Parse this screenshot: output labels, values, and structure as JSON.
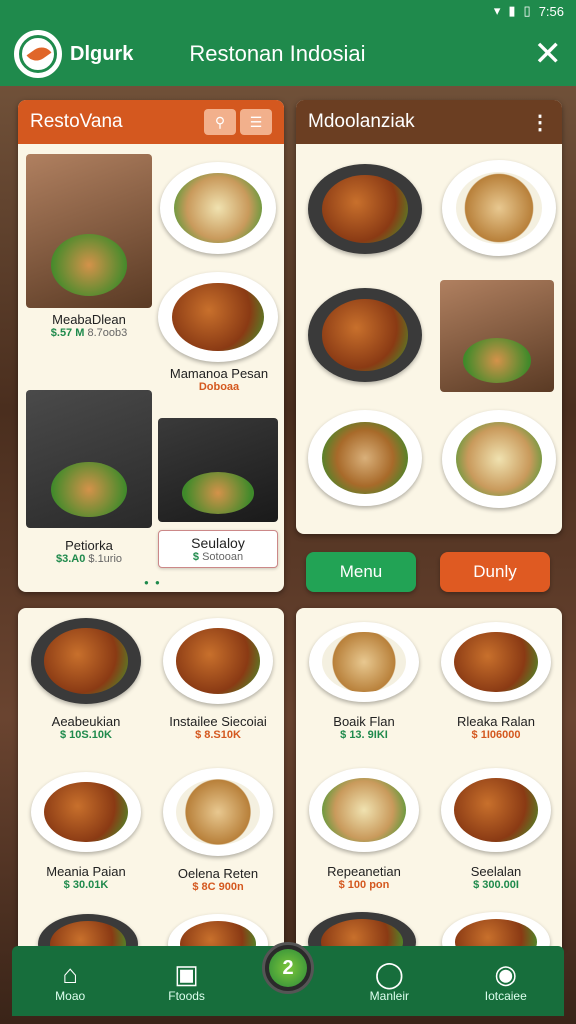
{
  "status": {
    "time": "7:56"
  },
  "app": {
    "brand": "Dlgurk",
    "title": "Restonan Indosiai"
  },
  "panels": {
    "left": {
      "title": "RestoVana"
    },
    "right": {
      "title": "Mdoolanziak"
    }
  },
  "left_items": [
    {
      "name": "MeabaDlean",
      "price": "$.57 M",
      "sub": "8.7oob3"
    },
    {
      "name": "Mamanoa Pesan",
      "price": "",
      "sub": "Doboaa"
    },
    {
      "name": "Petiorka",
      "price": "$3.A0",
      "sub": "$.1urio"
    },
    {
      "name": "Seulaloy",
      "price": "$",
      "sub": "Sotooan"
    }
  ],
  "buttons": {
    "menu": "Menu",
    "dunly": "Dunly"
  },
  "grid_left": [
    {
      "name": "Aeabeukian",
      "price": "$ 10S.10K"
    },
    {
      "name": "Instailee Siecoiai",
      "price": "$ 8.S10K"
    },
    {
      "name": "Meania Paian",
      "price": "$ 30.01K"
    },
    {
      "name": "Oelena Reten",
      "price": "$ 8C 900n"
    }
  ],
  "grid_right": [
    {
      "name": "Boaik Flan",
      "price": "$ 13. 9IKI"
    },
    {
      "name": "Rleaka Ralan",
      "price": "$ 1I06000"
    },
    {
      "name": "Repeanetian",
      "price": "$ 100 pon"
    },
    {
      "name": "Seelalan",
      "price": "$ 300.00I"
    }
  ],
  "nav": {
    "home": "Moao",
    "foods": "Ftoods",
    "center": "2",
    "market": "Manleir",
    "profile": "Iotcaiee"
  }
}
